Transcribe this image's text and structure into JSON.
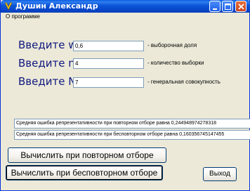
{
  "window": {
    "title": "Душин Александр"
  },
  "menu": {
    "about_label": "О программе"
  },
  "form": {
    "w": {
      "label": "Введите w:",
      "value": "0,6",
      "hint": "- выборочная доля"
    },
    "n": {
      "label": "Введите n:",
      "value": "4",
      "hint": "- количество выборки"
    },
    "N": {
      "label": "Введите N:",
      "value": "7",
      "hint": "- генеральная совокупность"
    }
  },
  "results": {
    "repeated": "Средняя ошибка репрезентативности при повторном отборе равна 0,244948974278318",
    "non_repeated": "Средняя ошибка репрезентативности при бесповторном отборе равна 0,160356745147455"
  },
  "buttons": {
    "calc_repeated": "Вычислить при повторном отборе",
    "calc_non_repeated": "Вычислить при бесповторном отборе",
    "exit": "Выход"
  }
}
